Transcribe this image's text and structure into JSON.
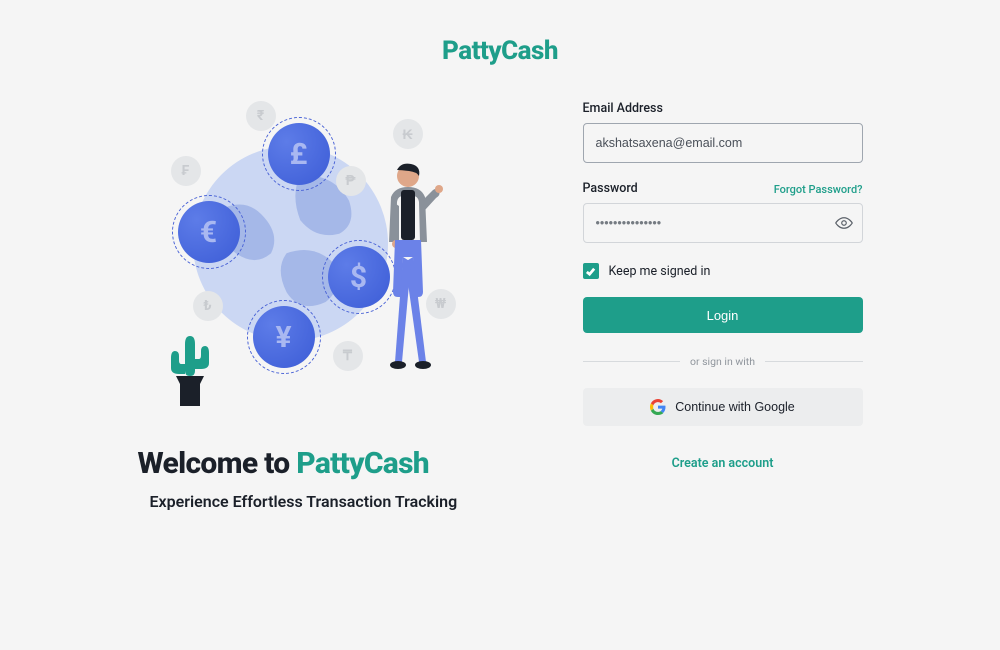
{
  "brand": "PattyCash",
  "welcome": {
    "heading_prefix": "Welcome to ",
    "heading_brand": "PattyCash",
    "subhead": "Experience Effortless Transaction Tracking"
  },
  "form": {
    "email_label": "Email Address",
    "email_placeholder": "akshatsaxena@email.com",
    "password_label": "Password",
    "forgot": "Forgot Password?",
    "password_placeholder": "•••••••••••••••",
    "keep_signed": "Keep me signed in",
    "login_button": "Login",
    "divider": "or sign in with",
    "google_button": "Continue with Google",
    "create_account": "Create an account"
  },
  "colors": {
    "accent": "#1e9e8a"
  },
  "coin_symbols": {
    "pound": "£",
    "euro": "€",
    "dollar": "$",
    "yen": "¥"
  }
}
